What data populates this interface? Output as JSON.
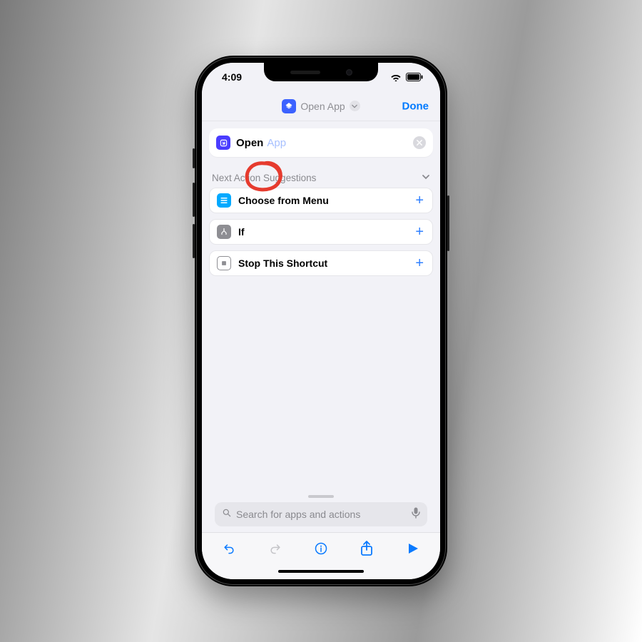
{
  "status": {
    "time": "4:09"
  },
  "nav": {
    "title": "Open App",
    "done": "Done"
  },
  "action": {
    "verb": "Open",
    "param": "App"
  },
  "suggestions": {
    "header": "Next Action Suggestions",
    "items": [
      {
        "label": "Choose from Menu"
      },
      {
        "label": "If"
      },
      {
        "label": "Stop This Shortcut"
      }
    ]
  },
  "search": {
    "placeholder": "Search for apps and actions"
  }
}
